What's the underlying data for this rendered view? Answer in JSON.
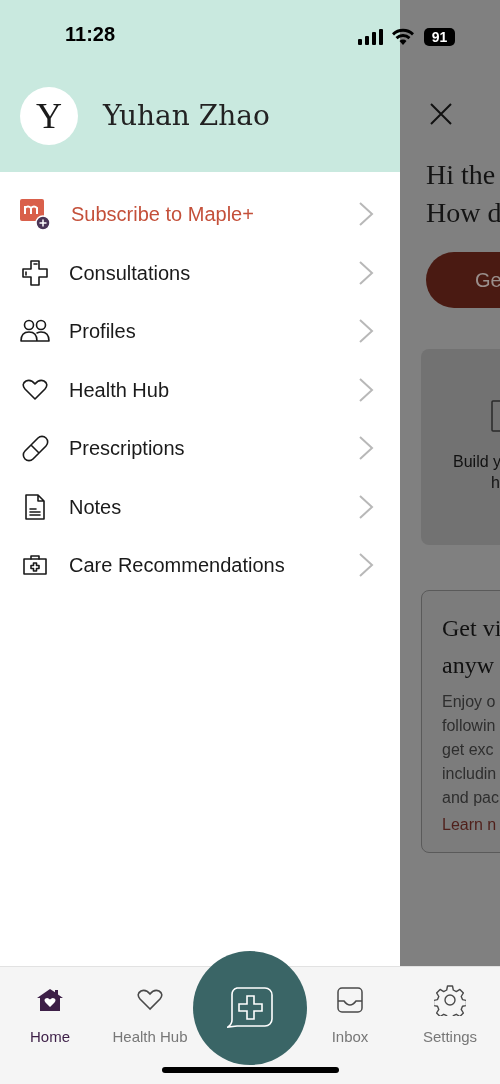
{
  "status_bar": {
    "time": "11:28",
    "battery": "91"
  },
  "drawer": {
    "user": {
      "initial": "Y",
      "name": "Yuhan Zhao"
    },
    "items": [
      {
        "kind": "promo",
        "label": "Subscribe to Maple+"
      },
      {
        "kind": "link",
        "label": "Consultations"
      },
      {
        "kind": "link",
        "label": "Profiles"
      },
      {
        "kind": "link",
        "label": "Health Hub"
      },
      {
        "kind": "link",
        "label": "Prescriptions"
      },
      {
        "kind": "link",
        "label": "Notes"
      },
      {
        "kind": "link",
        "label": "Care Recommendations"
      }
    ]
  },
  "background_screen": {
    "greeting": [
      "Hi the",
      "How d"
    ],
    "button": "Ge",
    "card": [
      "Build y",
      "h"
    ],
    "promo_card": {
      "title": [
        "Get vi",
        "anyw"
      ],
      "body": [
        "Enjoy o",
        "followin",
        "get exc",
        "includin",
        "and pac"
      ],
      "link": "Learn n"
    }
  },
  "tab_bar": [
    {
      "label": "Home",
      "selected": true
    },
    {
      "label": "Health Hub",
      "selected": false
    },
    {
      "kind": "action"
    },
    {
      "label": "Inbox",
      "selected": false
    },
    {
      "label": "Settings",
      "selected": false
    }
  ]
}
